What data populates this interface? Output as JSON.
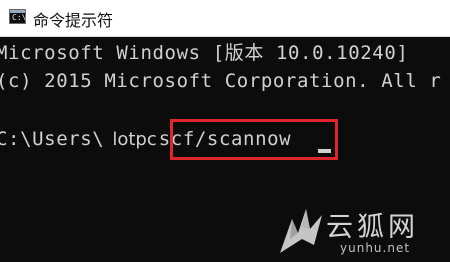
{
  "window": {
    "title": "命令提示符",
    "icon": "cmd-app-icon",
    "icon_glyph": "C:\\"
  },
  "console": {
    "line1": "Microsoft Windows [版本 10.0.10240]",
    "line2": "(c) 2015 Microsoft Corporation. All r",
    "prompt_path": "C:\\Users\\",
    "prompt_user": "lotpc",
    "command": "scf/scannow"
  },
  "highlight": {
    "color": "#e0262d"
  },
  "watermark": {
    "text": "云狐网",
    "url": "yunhu.net"
  },
  "colors": {
    "background": "#0c0c0c",
    "text": "#d0d0d0",
    "titlebar": "#ffffff"
  }
}
